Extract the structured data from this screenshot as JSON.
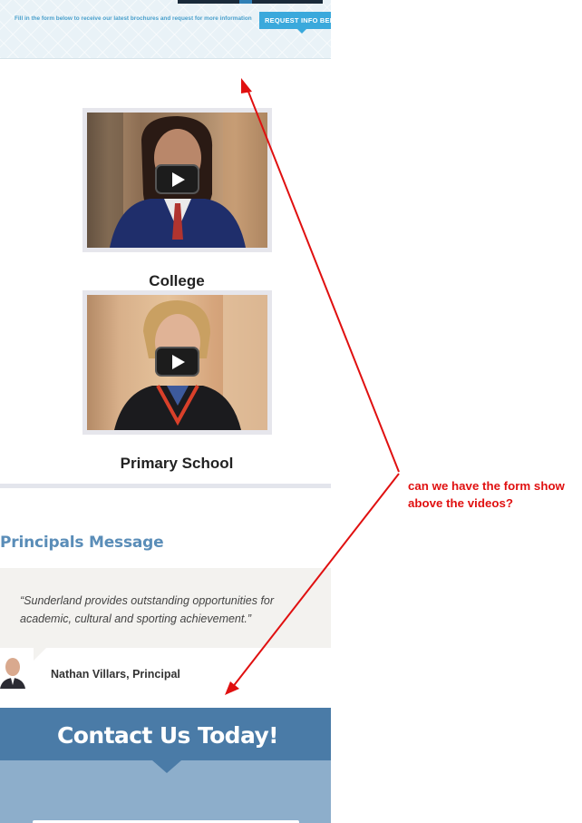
{
  "banner": {
    "intro_text": "Fill in the form below to receive our latest brochures and request for more information",
    "request_button": "REQUEST INFO BELOW"
  },
  "videos": [
    {
      "title": "College"
    },
    {
      "title": "Primary School"
    }
  ],
  "principal": {
    "section_title": "Principals Message",
    "quote": "“Sunderland provides outstanding opportunities for academic, cultural and sporting achievement.”",
    "name": "Nathan Villars, Principal"
  },
  "contact": {
    "title": "Contact Us Today!"
  },
  "annotation": {
    "text": "can we have the form show above the videos?",
    "color": "#e01010"
  },
  "colors": {
    "accent_blue": "#4a7ba7",
    "heading_blue": "#5a8db8",
    "button_blue": "#3aa9dc"
  }
}
